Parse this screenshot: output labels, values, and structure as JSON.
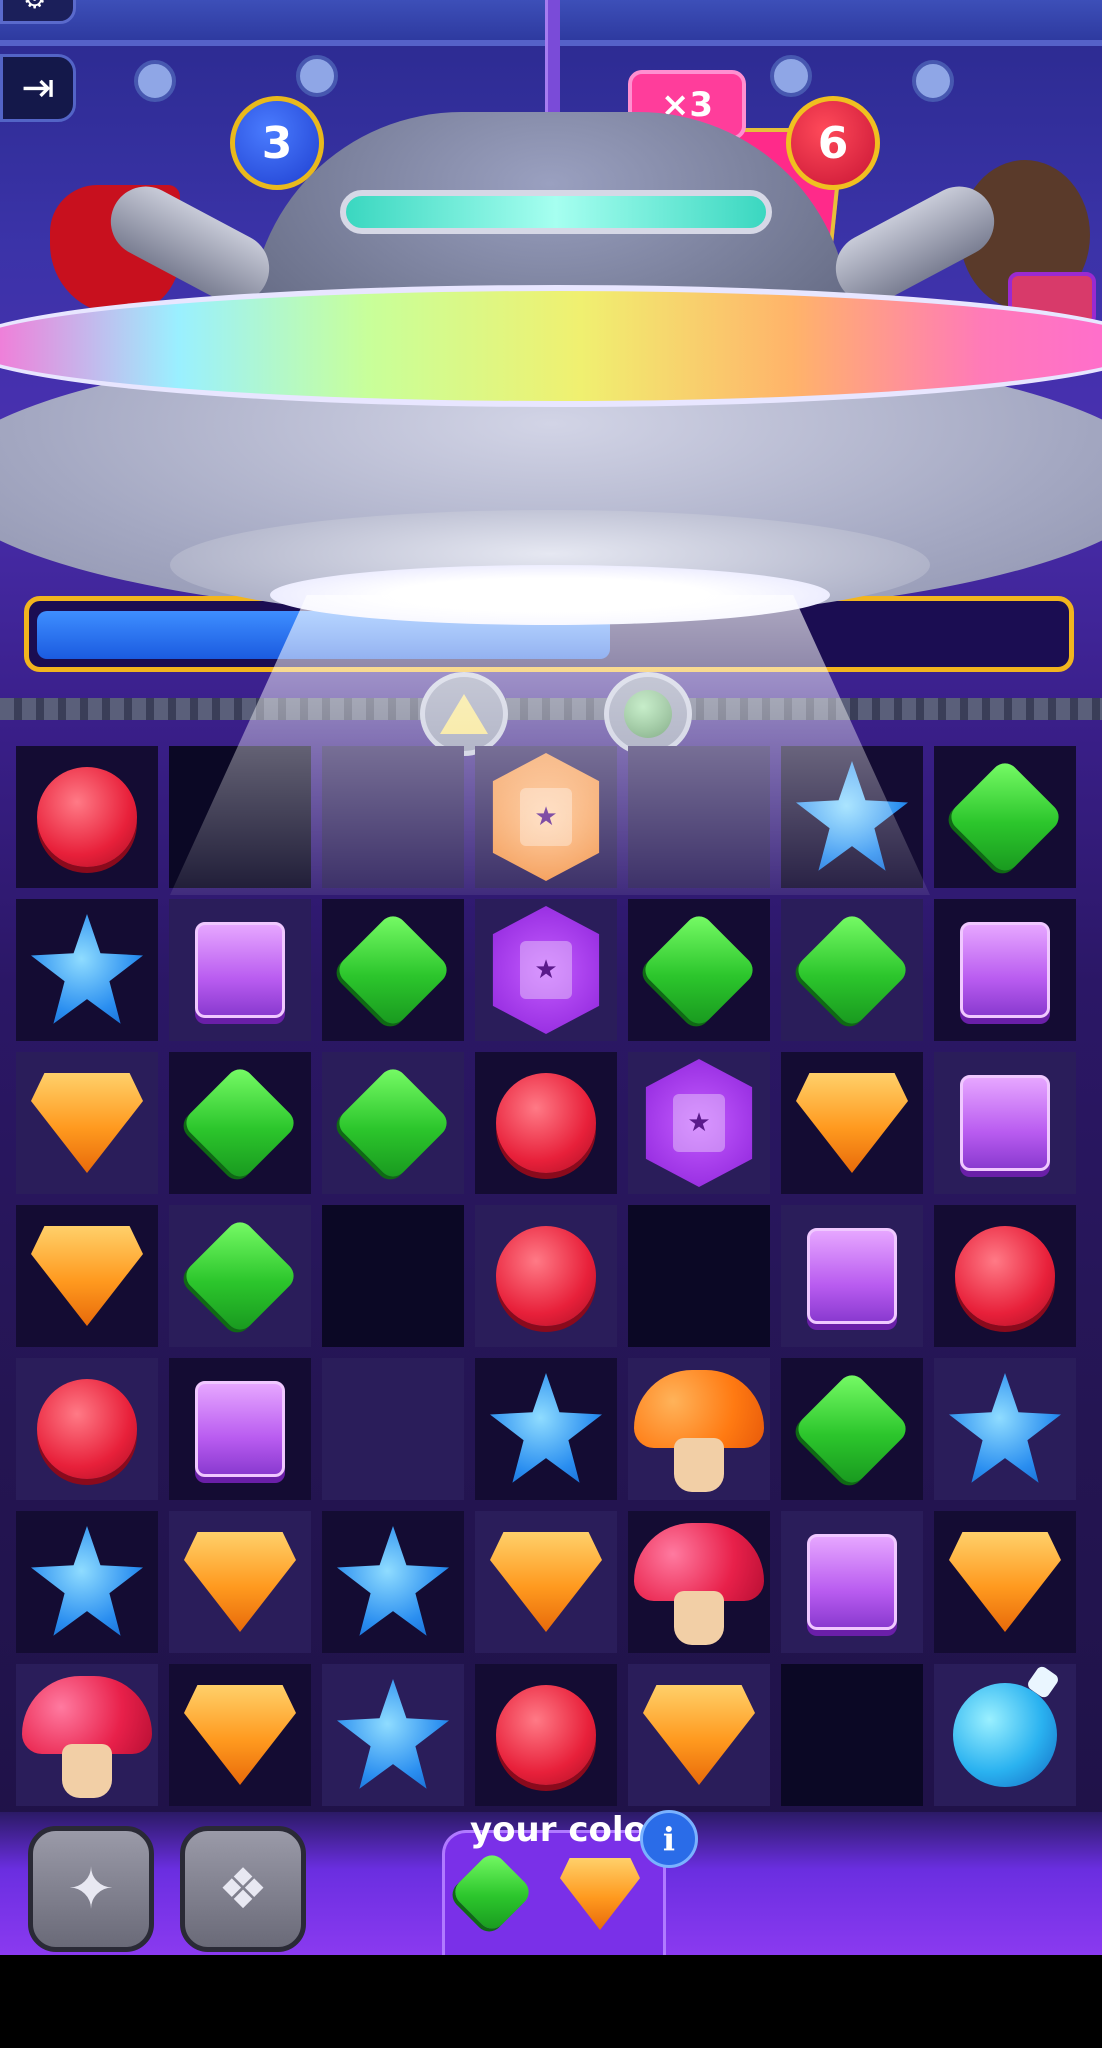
{
  "header": {
    "player_score": "3",
    "opponent_score": "6",
    "multiplier": "×3",
    "exit_icon": "exit-icon",
    "settings_icon": "gear-icon"
  },
  "progress": {
    "level": 0.56
  },
  "board": {
    "columns": 7,
    "rows": 7,
    "cells": [
      [
        {
          "bg": "dark",
          "piece": "red"
        },
        {
          "bg": "hole",
          "piece": ""
        },
        {
          "bg": "light",
          "piece": ""
        },
        {
          "bg": "light",
          "piece": "book-orange"
        },
        {
          "bg": "light",
          "piece": ""
        },
        {
          "bg": "dark",
          "piece": "blue"
        },
        {
          "bg": "dark",
          "piece": "green"
        }
      ],
      [
        {
          "bg": "dark",
          "piece": "blue"
        },
        {
          "bg": "light",
          "piece": "purple"
        },
        {
          "bg": "dark",
          "piece": "green"
        },
        {
          "bg": "light",
          "piece": "book-purple"
        },
        {
          "bg": "dark",
          "piece": "green"
        },
        {
          "bg": "light",
          "piece": "green"
        },
        {
          "bg": "dark",
          "piece": "purple"
        }
      ],
      [
        {
          "bg": "light",
          "piece": "orange"
        },
        {
          "bg": "dark",
          "piece": "green"
        },
        {
          "bg": "light",
          "piece": "green"
        },
        {
          "bg": "dark",
          "piece": "red"
        },
        {
          "bg": "light",
          "piece": "book-purple"
        },
        {
          "bg": "dark",
          "piece": "orange"
        },
        {
          "bg": "light",
          "piece": "purple"
        }
      ],
      [
        {
          "bg": "dark",
          "piece": "orange"
        },
        {
          "bg": "light",
          "piece": "green"
        },
        {
          "bg": "hole",
          "piece": ""
        },
        {
          "bg": "light",
          "piece": "red"
        },
        {
          "bg": "hole",
          "piece": ""
        },
        {
          "bg": "light",
          "piece": "purple"
        },
        {
          "bg": "dark",
          "piece": "red"
        }
      ],
      [
        {
          "bg": "light",
          "piece": "red"
        },
        {
          "bg": "dark",
          "piece": "purple"
        },
        {
          "bg": "light",
          "piece": ""
        },
        {
          "bg": "dark",
          "piece": "blue"
        },
        {
          "bg": "light",
          "piece": "mush-orange"
        },
        {
          "bg": "dark",
          "piece": "green"
        },
        {
          "bg": "light",
          "piece": "blue"
        }
      ],
      [
        {
          "bg": "dark",
          "piece": "blue"
        },
        {
          "bg": "light",
          "piece": "orange"
        },
        {
          "bg": "dark",
          "piece": "blue"
        },
        {
          "bg": "light",
          "piece": "orange"
        },
        {
          "bg": "dark",
          "piece": "mush-red"
        },
        {
          "bg": "light",
          "piece": "purple"
        },
        {
          "bg": "dark",
          "piece": "orange"
        }
      ],
      [
        {
          "bg": "light",
          "piece": "mush-red"
        },
        {
          "bg": "dark",
          "piece": "orange"
        },
        {
          "bg": "light",
          "piece": "blue"
        },
        {
          "bg": "dark",
          "piece": "red"
        },
        {
          "bg": "light",
          "piece": "orange"
        },
        {
          "bg": "hole",
          "piece": ""
        },
        {
          "bg": "light",
          "piece": "bomb"
        }
      ]
    ]
  },
  "footer": {
    "your_colors_label": "your colors",
    "info_label": "i",
    "your_colors": [
      "green",
      "orange"
    ],
    "boosters": [
      "stars-booster",
      "scarab-booster"
    ]
  },
  "colors": {
    "accent_gold": "#f2b51e",
    "progress_blue": "#2a6cf0",
    "opponent_red": "#e8203a",
    "player_blue": "#2a50e0"
  }
}
